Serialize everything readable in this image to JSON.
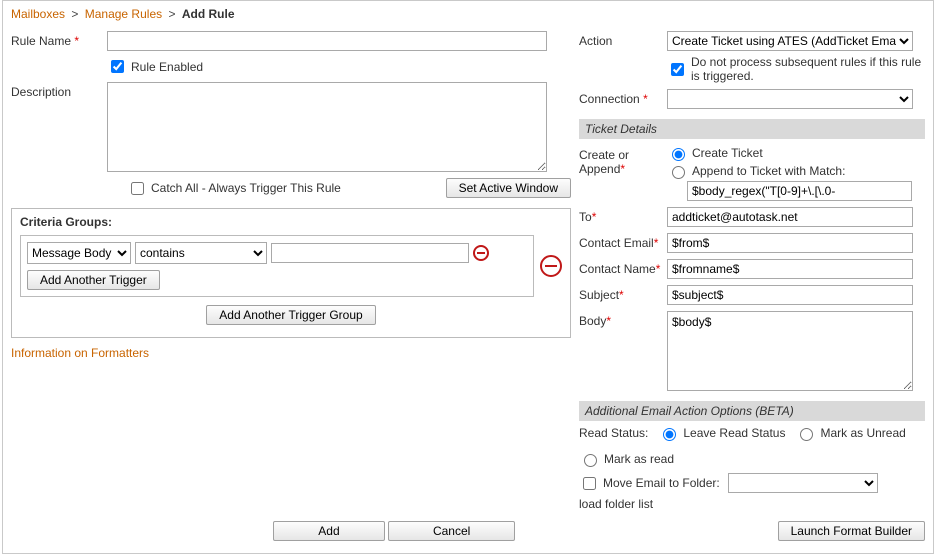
{
  "breadcrumb": {
    "l1": "Mailboxes",
    "l2": "Manage Rules",
    "current": "Add Rule"
  },
  "left": {
    "rule_name_label": "Rule Name",
    "rule_name_value": "",
    "rule_enabled_label": "Rule Enabled",
    "rule_enabled_checked": true,
    "description_label": "Description",
    "description_value": "",
    "catch_all_label": "Catch All - Always Trigger This Rule",
    "catch_all_checked": false,
    "set_active_btn": "Set Active Window",
    "criteria_title": "Criteria Groups:",
    "criteria": {
      "field_options": [
        "Message Body"
      ],
      "field_selected": "Message Body",
      "op_options": [
        "contains"
      ],
      "op_selected": "contains",
      "value": ""
    },
    "add_trigger_btn": "Add Another Trigger",
    "add_group_btn": "Add Another Trigger Group",
    "info_link": "Information on Formatters"
  },
  "right": {
    "action_label": "Action",
    "action_value": "Create Ticket using ATES (AddTicket Email Servic",
    "stop_processing_label": "Do not process subsequent rules if this rule is triggered.",
    "stop_processing_checked": true,
    "connection_label": "Connection",
    "connection_value": "",
    "ticket_details_header": "Ticket Details",
    "create_or_append_label": "Create or Append",
    "create_ticket_label": "Create Ticket",
    "append_label": "Append to Ticket with Match:",
    "append_value": "$body_regex(\"T[0-9]+\\.[\\.0-",
    "to_label": "To",
    "to_value": "addticket@autotask.net",
    "contact_email_label": "Contact Email",
    "contact_email_value": "$from$",
    "contact_name_label": "Contact Name",
    "contact_name_value": "$fromname$",
    "subject_label": "Subject",
    "subject_value": "$subject$",
    "body_label": "Body",
    "body_value": "$body$",
    "addl_header": "Additional Email Action Options (BETA)",
    "read_status_label": "Read Status:",
    "read_leave": "Leave Read Status",
    "read_unread": "Mark as Unread",
    "read_read": "Mark as read",
    "move_label": "Move Email to Folder:",
    "load_folder": "load folder list"
  },
  "footer": {
    "add": "Add",
    "cancel": "Cancel",
    "launch": "Launch Format Builder"
  }
}
